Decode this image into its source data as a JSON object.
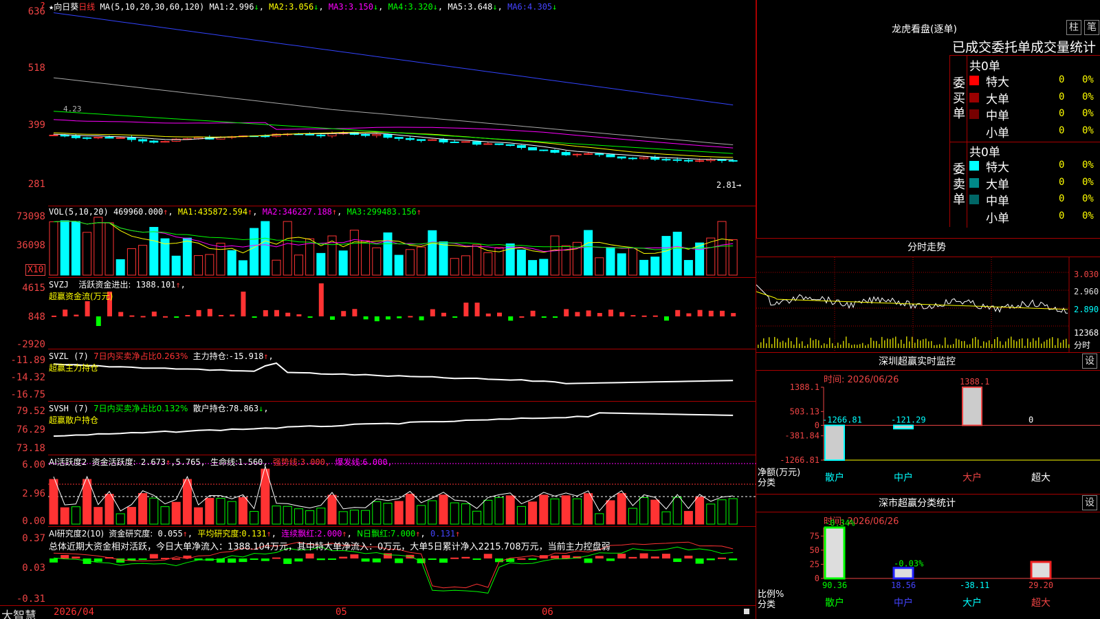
{
  "window": {
    "corner": "?",
    "stock_name": "★向日葵",
    "period": "日线",
    "app_name": "大智慧"
  },
  "colors": {
    "up": "#ff3333",
    "down": "#00ffff",
    "grid": "#aa0000",
    "axis_label": "#ee4444",
    "ma1": "#ffffff",
    "ma2": "#ffff00",
    "ma3": "#ff00ff",
    "ma4": "#00ff00",
    "ma5": "#aaaaaa",
    "ma6": "#3344ff"
  },
  "main": {
    "params": "MA(5,10,20,30,60,120)",
    "ma": [
      {
        "label": "MA1:",
        "value": "2.996",
        "dir": "↓"
      },
      {
        "label": "MA2:",
        "value": "3.056",
        "dir": "↓"
      },
      {
        "label": "MA3:",
        "value": "3.150",
        "dir": "↓"
      },
      {
        "label": "MA4:",
        "value": "3.320",
        "dir": "↓"
      },
      {
        "label": "MA5:",
        "value": "3.648",
        "dir": "↓"
      },
      {
        "label": "MA6:",
        "value": "4.305",
        "dir": "↓"
      }
    ],
    "y_labels": [
      "636",
      "518",
      "399",
      "281"
    ],
    "last_price": "2.81",
    "tag_high": "4.23"
  },
  "vol": {
    "params": "VOL(5,10,20)",
    "value": "469960.000",
    "ma": [
      {
        "label": "MA1:",
        "value": "435872.594",
        "dir": "↑"
      },
      {
        "label": "MA2:",
        "value": "346227.188",
        "dir": "↑"
      },
      {
        "label": "MA3:",
        "value": "299483.156",
        "dir": "↑"
      }
    ],
    "y_labels": [
      "73098",
      "36098"
    ],
    "unit": "X10"
  },
  "svzj": {
    "name": "SVZJ",
    "label": "活跃资金进出:",
    "value": "1388.101",
    "dir": "↑",
    "sub": "超赢资金流(万元)",
    "y_labels": [
      "4615",
      "848",
      "-2920"
    ]
  },
  "svzl": {
    "name": "SVZL (7)",
    "label": "7日内买卖净占比0.263%",
    "label2": "主力持仓:",
    "value": "-15.918",
    "dir": "↑",
    "sub": "超赢主力持仓",
    "y_labels": [
      "-11.89",
      "-14.32",
      "-16.75"
    ]
  },
  "svsh": {
    "name": "SVSH (7)",
    "label": "7日内买卖净占比0.132%",
    "label2": "散户持仓:",
    "value": "78.863",
    "dir": "↓",
    "sub": "超赢散户持仓",
    "y_labels": [
      "79.52",
      "76.29",
      "73.18"
    ]
  },
  "ai1": {
    "name": "AI活跃度2",
    "label": "资金活跃度:",
    "value": "2.673",
    "dir": "↑",
    "v2": "5.765",
    "life_label": "生命线:",
    "life": "1.560",
    "strong_label": "强势线:",
    "strong": "3.000",
    "burst_label": "爆发线:",
    "burst": "6.000",
    "y_labels": [
      "6.00",
      "2.96",
      "0.00"
    ]
  },
  "ai2": {
    "name": "AI研究度2(10)",
    "label": "资金研究度:",
    "value": "0.055",
    "dir": "↑",
    "avg_label": "平均研究度:",
    "avg": "0.131",
    "lx_label": "连续飘红:",
    "lx": "2.000",
    "n_label": "N日飘红:",
    "n": "7.000",
    "v5": "0.131",
    "comment": "总体近期大资金相对活跃，今日大单净流入：1388.104万元，其中特大单净流入：0万元，大单5日累计净入2215.708万元，当前主力控盘弱",
    "y_labels": [
      "0.37",
      "0.03",
      "-0.31"
    ]
  },
  "xaxis": {
    "labels": [
      "2026/04",
      "05",
      "06"
    ]
  },
  "dragon": {
    "title": "龙虎看盘(逐单)",
    "btn1": "柱",
    "btn2": "笔",
    "subtitle": "已成交委托单成交量统计",
    "buy_side": "委买单",
    "sell_side": "委卖单",
    "buy_total": "共0单",
    "sell_total": "共0单",
    "buy_rows": [
      {
        "name": "特大",
        "count": "0",
        "pct": "0%",
        "color": "#ff0000"
      },
      {
        "name": "大单",
        "count": "0",
        "pct": "0%",
        "color": "#990000"
      },
      {
        "name": "中单",
        "count": "0",
        "pct": "0%",
        "color": "#770000"
      },
      {
        "name": "小单",
        "count": "0",
        "pct": "0%",
        "color": ""
      }
    ],
    "sell_rows": [
      {
        "name": "特大",
        "count": "0",
        "pct": "0%",
        "color": "#00ffff"
      },
      {
        "name": "大单",
        "count": "0",
        "pct": "0%",
        "color": "#008888"
      },
      {
        "name": "中单",
        "count": "0",
        "pct": "0%",
        "color": "#006666"
      },
      {
        "name": "小单",
        "count": "0",
        "pct": "0%",
        "color": ""
      }
    ]
  },
  "intraday": {
    "title": "分时走势",
    "y_labels": [
      "3.030",
      "2.960",
      "2.890"
    ],
    "vol_label": "12368",
    "vol_unit": "分时"
  },
  "monitor": {
    "title": "深圳超赢实时监控",
    "btn": "设",
    "date": "时间: 2026/06/26",
    "y_labels": [
      "1388.1",
      "503.13",
      "0",
      "-381.84",
      "-1266.81"
    ],
    "ylabel": "净额(万元)",
    "xlabel": "分类",
    "chart_data": {
      "type": "bar",
      "categories": [
        "散户",
        "中户",
        "大户",
        "超大"
      ],
      "values": [
        -1266.81,
        -121.29,
        1388.1,
        0
      ],
      "value_labels": [
        "-1266.81",
        "-121.29",
        "1388.1",
        "0"
      ],
      "ylim": [
        -1266.81,
        1388.1
      ]
    }
  },
  "classify": {
    "title": "深市超赢分类统计",
    "btn": "设",
    "date": "时间: 2026/06/26",
    "y_labels": [
      "75",
      "50",
      "25",
      "0"
    ],
    "ylabel": "比例%",
    "xlabel": "分类",
    "chart_data": {
      "type": "bar",
      "categories": [
        "散户",
        "中户",
        "大户",
        "超大"
      ],
      "values": [
        90.36,
        18.56,
        -38.11,
        29.2
      ],
      "bar_pct": [
        90.36,
        18.56,
        0,
        29.2
      ],
      "top_labels": [
        "-0.34%",
        "-0.03%",
        "",
        ""
      ],
      "value_labels": [
        "90.36",
        "18.56",
        "-38.11",
        "29.20"
      ],
      "ylim": [
        0,
        90
      ]
    }
  }
}
